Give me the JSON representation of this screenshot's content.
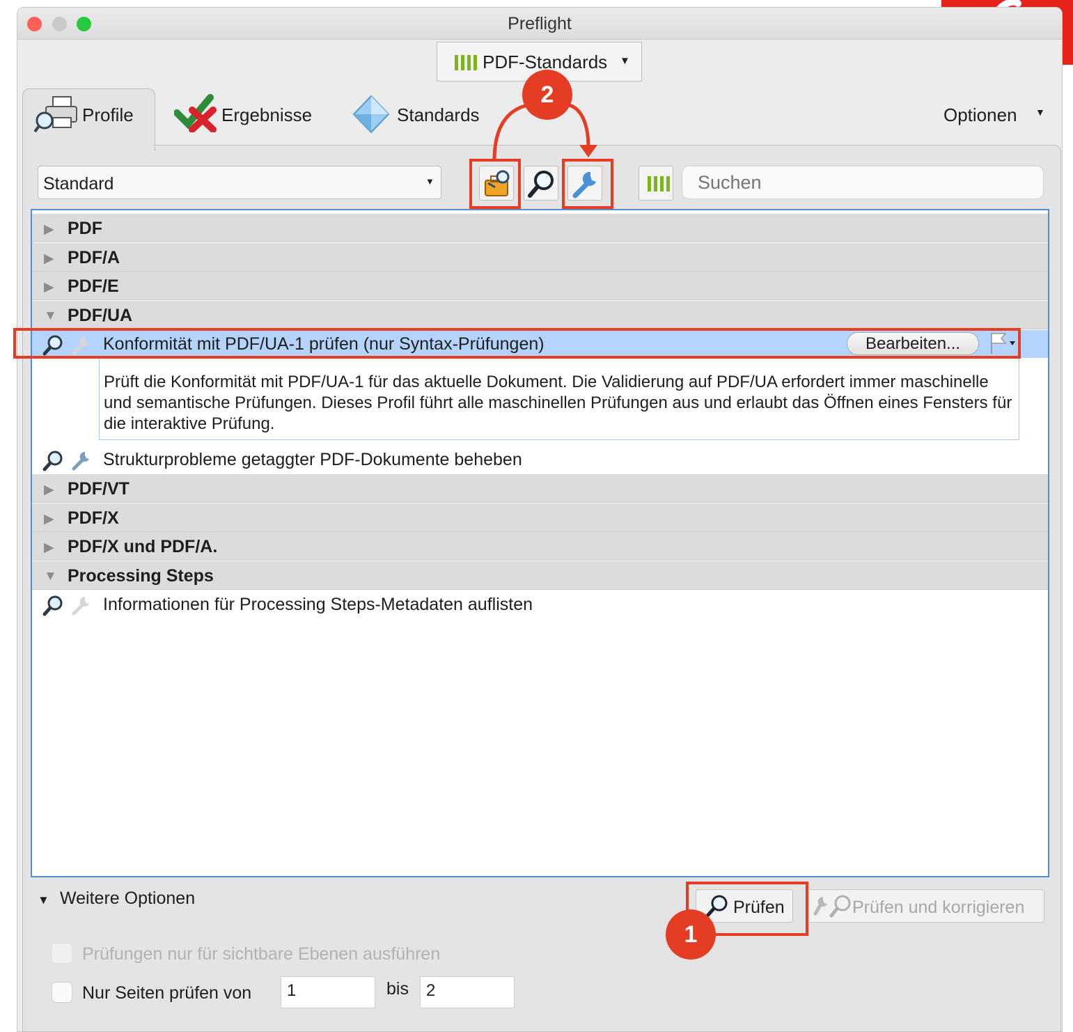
{
  "window": {
    "title": "Preflight"
  },
  "top_dropdown": {
    "label": "PDF-Standards"
  },
  "tabs": [
    {
      "label": "Profile",
      "active": true
    },
    {
      "label": "Ergebnisse",
      "active": false
    },
    {
      "label": "Standards",
      "active": false
    }
  ],
  "options_menu": {
    "label": "Optionen"
  },
  "profile_select": {
    "value": "Standard"
  },
  "search": {
    "placeholder": "Suchen"
  },
  "groups": {
    "pdf": "PDF",
    "pdfa": "PDF/A",
    "pdfe": "PDF/E",
    "pdfua": "PDF/UA",
    "pdfvt": "PDF/VT",
    "pdfx": "PDF/X",
    "pdfx_pdfa": "PDF/X und PDF/A.",
    "processing": "Processing Steps"
  },
  "items": {
    "ua_syntax": "Konformität mit PDF/UA-1 prüfen (nur Syntax-Prüfungen)",
    "ua_syntax_desc": "Prüft die Konformität mit PDF/UA-1 für das aktuelle Dokument. Die Validierung auf PDF/UA erfordert immer maschinelle und semantische Prüfungen. Dieses Profil führt alle maschinellen Prüfungen aus und erlaubt das Öffnen eines Fensters für die interaktive Prüfung.",
    "fix_structure": "Strukturprobleme getaggter PDF-Dokumente beheben",
    "processing_meta": "Informationen für Processing Steps-Metadaten auflisten"
  },
  "edit_button": {
    "label": "Bearbeiten..."
  },
  "bottom": {
    "more_options": "Weitere Optionen",
    "check_button": "Prüfen",
    "check_fix_button": "Prüfen und korrigieren",
    "visible_layers": "Prüfungen nur für sichtbare Ebenen ausführen",
    "pages_from": "Nur Seiten prüfen von",
    "from_value": "1",
    "to_label": "bis",
    "to_value": "2"
  },
  "markers": {
    "one": "1",
    "two": "2"
  },
  "colors": {
    "annotation": "#e43d24",
    "selection": "#b4d4fb",
    "brand": "#e6231b",
    "bars": "#7cb51a"
  }
}
